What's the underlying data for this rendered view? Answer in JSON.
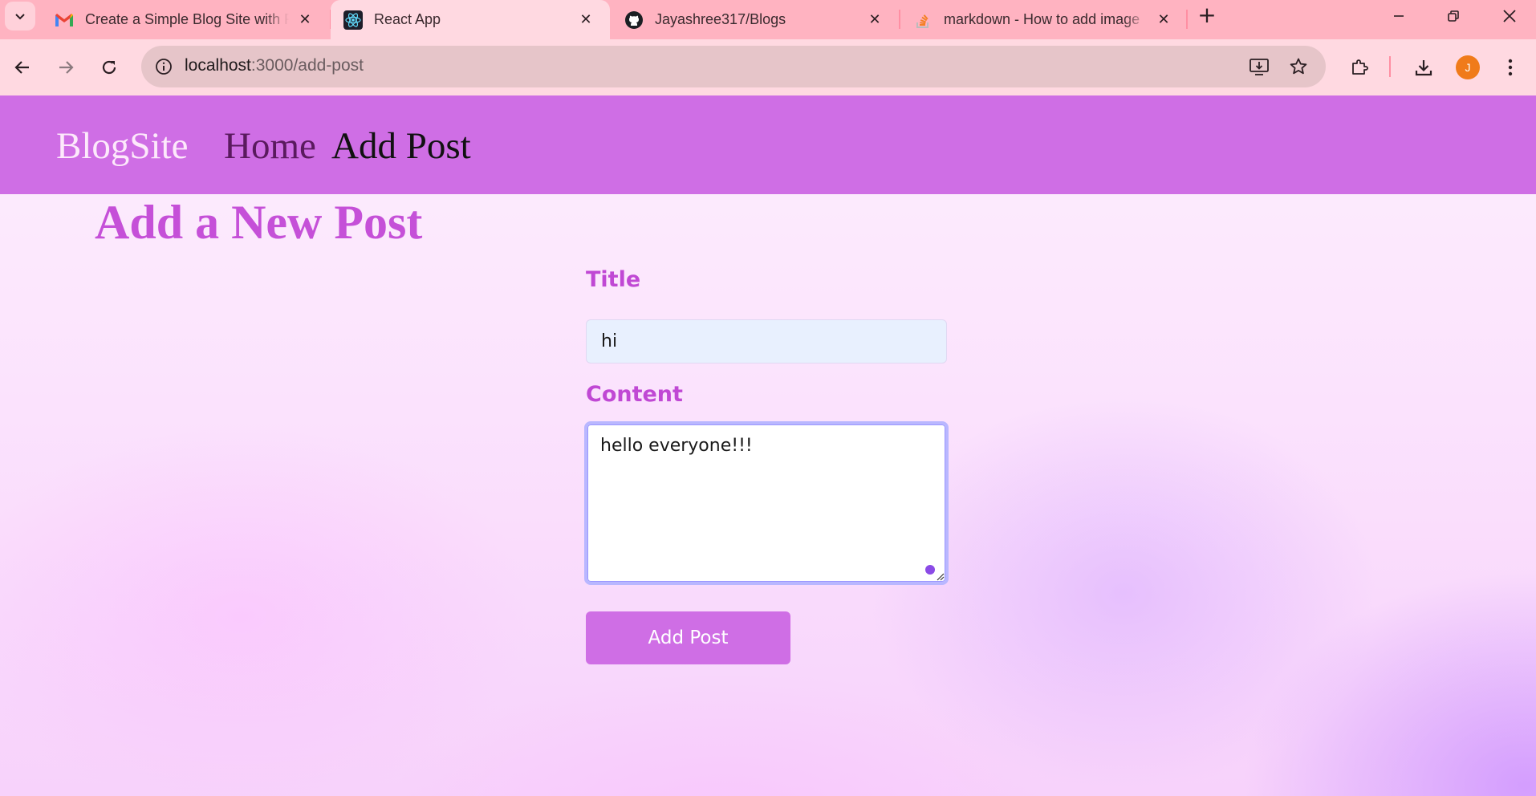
{
  "browser": {
    "tabs": [
      {
        "title": "Create a Simple Blog Site with R",
        "favicon": "gmail-icon",
        "active": false
      },
      {
        "title": "React App",
        "favicon": "react-icon",
        "active": true
      },
      {
        "title": "Jayashree317/Blogs",
        "favicon": "github-icon",
        "active": false
      },
      {
        "title": "markdown - How to add image",
        "favicon": "stackoverflow-icon",
        "active": false
      }
    ],
    "new_tab_label": "+",
    "url_host": "localhost",
    "url_path": ":3000/add-post",
    "profile_initial": "J",
    "colors": {
      "tabstrip": "#ffb3c1",
      "toolbar": "#ffd9e1",
      "omnibox": "#e6c5c9",
      "avatar": "#f07b1a"
    }
  },
  "page": {
    "brand": "BlogSite",
    "nav": {
      "home": "Home",
      "add_post": "Add Post"
    },
    "heading": "Add a New Post",
    "form": {
      "title_label": "Title",
      "title_value": "hi",
      "content_label": "Content",
      "content_value": "hello everyone!!!",
      "submit_label": "Add Post"
    },
    "colors": {
      "navbar": "#cf6ee5",
      "heading": "#c550d8",
      "label": "#c048d4",
      "button": "#cf6ee5"
    }
  }
}
